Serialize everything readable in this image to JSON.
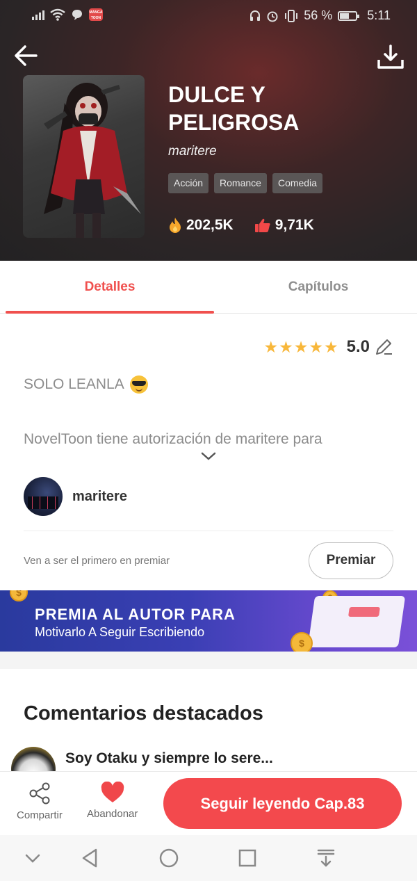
{
  "status_bar": {
    "app_badge": "MANGA TOON",
    "battery": "56 %",
    "time": "5:11"
  },
  "book": {
    "title": "DULCE Y PELIGROSA",
    "author": "maritere",
    "tags": [
      "Acción",
      "Romance",
      "Comedia"
    ],
    "views": "202,5K",
    "likes": "9,71K"
  },
  "tabs": {
    "details": "Detalles",
    "chapters": "Capítulos"
  },
  "rating": {
    "stars": 5,
    "value": "5.0"
  },
  "description": {
    "line1": "SOLO LEANLA",
    "line2": "NovelToon tiene autorización de maritere para"
  },
  "author_row": {
    "name": "maritere"
  },
  "reward": {
    "prompt": "Ven a ser el primero en premiar",
    "button": "Premiar"
  },
  "banner": {
    "title": "PREMIA AL AUTOR PARA",
    "subtitle": "Motivarlo A Seguir Escribiendo",
    "coin_symbol": "$"
  },
  "comments": {
    "heading": "Comentarios destacados",
    "first": "Soy Otaku y siempre lo sere..."
  },
  "actions": {
    "share": "Compartir",
    "abandon": "Abandonar",
    "continue": "Seguir leyendo Cap.83"
  },
  "colors": {
    "accent": "#f0504e",
    "star": "#f8b73a"
  }
}
